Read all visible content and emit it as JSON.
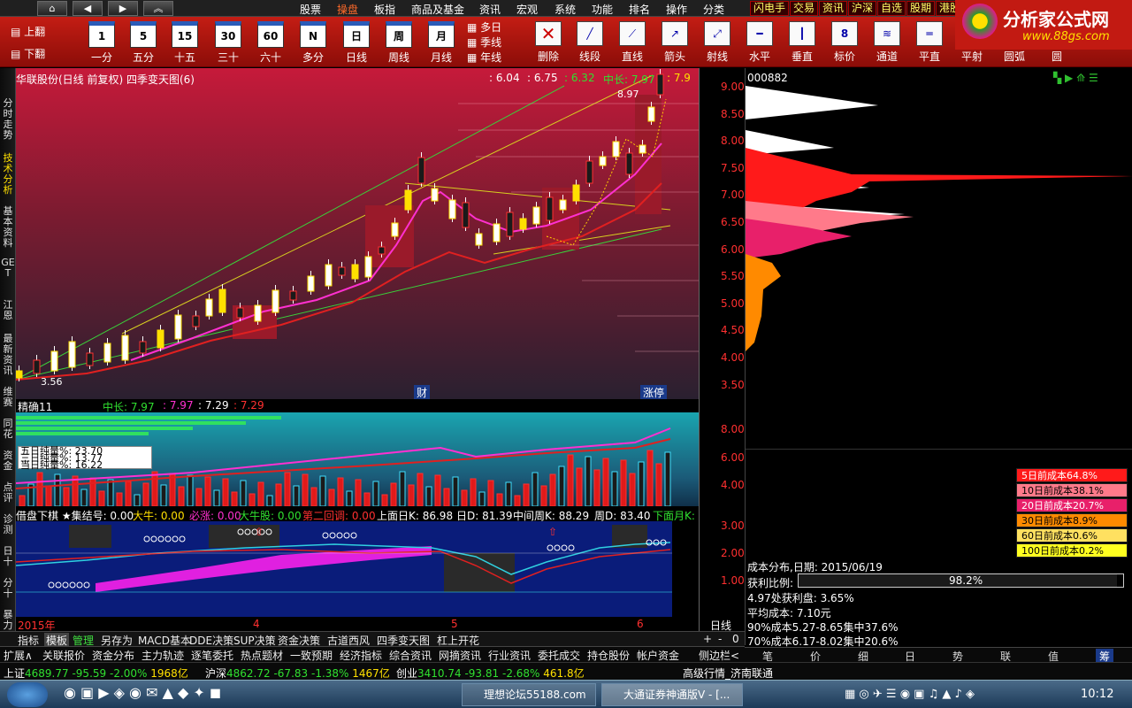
{
  "menubar": {
    "items": [
      "股票",
      "操盘",
      "板指",
      "商品及基金",
      "资讯",
      "宏观",
      "系统",
      "功能",
      "排名",
      "操作",
      "分类"
    ],
    "active_index": 1,
    "quick": [
      "闪电手",
      "交易",
      "资讯",
      "沪深",
      "自选",
      "股期",
      "港股"
    ],
    "nav": [
      "⌂",
      "◀",
      "▶",
      "︽"
    ]
  },
  "toolbar": {
    "flip": [
      "上翻",
      "下翻"
    ],
    "periods": [
      {
        "icon": "1",
        "label": "一分"
      },
      {
        "icon": "5",
        "label": "五分"
      },
      {
        "icon": "15",
        "label": "十五"
      },
      {
        "icon": "30",
        "label": "三十"
      },
      {
        "icon": "60",
        "label": "六十"
      },
      {
        "icon": "N",
        "label": "多分"
      },
      {
        "icon": "日",
        "label": "日线"
      },
      {
        "icon": "周",
        "label": "周线"
      },
      {
        "icon": "月",
        "label": "月线"
      }
    ],
    "multi": [
      "多日",
      "季线",
      "年线"
    ],
    "draw": [
      "删除",
      "线段",
      "直线",
      "箭头",
      "射线",
      "水平",
      "垂直",
      "标价",
      "通道",
      "平直",
      "平射",
      "圆弧",
      "圆"
    ]
  },
  "logo": {
    "title": "分析家公式网",
    "url": "www.88gs.com"
  },
  "leftnav": [
    "分时走势",
    "技术分析",
    "基本资料",
    "GET",
    "江恩",
    "最新资讯",
    "维赛",
    "同花",
    "资金",
    "点评",
    "诊测",
    "日十",
    "分十",
    "暴力"
  ],
  "main": {
    "title": "华联股份(日线 前复权) 四季变天图(6)",
    "vals": [
      ": 6.04",
      ": 6.75",
      ": 6.32",
      "中长: 7.97",
      ": 7.9"
    ],
    "price_labels": {
      "high": "8.97",
      "low": "3.56"
    },
    "badges": [
      "财",
      "涨停"
    ]
  },
  "scale_main": [
    "9.00",
    "8.50",
    "8.00",
    "7.50",
    "7.00",
    "6.50",
    "6.00",
    "5.50",
    "5.00",
    "4.50",
    "4.00",
    "3.50"
  ],
  "sub1": {
    "title": "精确11",
    "vals": [
      "中长: 7.97",
      ": 7.97",
      ": 7.29",
      ": 7.29"
    ],
    "legend": [
      "五日纯量%: 23.70",
      "三日纯量%: 13.77",
      "当日纯量%: 16.22"
    ]
  },
  "scale_sub1": [
    "8.00",
    "6.00",
    "4.00"
  ],
  "sub2": {
    "vals": [
      "借盘下棋 ★集结号: 0.00",
      "大牛: 0.00",
      "必涨: 0.00",
      "大牛股: 0.00",
      "第二回调: 0.00",
      "上面日K: 86.98",
      "日D: 81.39",
      "中间周K: 88.29",
      "周D: 83.40",
      "下面月K:"
    ]
  },
  "scale_sub2": [
    "3.00",
    "2.00",
    "1.00"
  ],
  "xaxis": {
    "labels": [
      "2015年",
      "4",
      "5",
      "6"
    ],
    "period": "日线"
  },
  "tabs1": [
    "指标",
    "模板",
    "管理",
    "另存为",
    "MACD基本",
    "DDE决策",
    "SUP决策",
    "资金决策",
    "古道西风",
    "四季变天图",
    "杠上开花"
  ],
  "tabs1_right": [
    "+",
    "-",
    "0"
  ],
  "tabs2": [
    "扩展∧",
    "关联报价",
    "资金分布",
    "主力轨迹",
    "逐笔委托",
    "热点题材",
    "一致预期",
    "经济指标",
    "综合资讯",
    "网摘资讯",
    "行业资讯",
    "委托成交",
    "持仓股份",
    "帐户资金",
    "侧边栏<"
  ],
  "right": {
    "code": "000882",
    "cost": [
      {
        "label": "5日前成本64.8%",
        "color": "#ff1a1a"
      },
      {
        "label": "10日前成本38.1%",
        "color": "#ff7a8a"
      },
      {
        "label": "20日前成本20.7%",
        "color": "#e8206a"
      },
      {
        "label": "30日前成本8.9%",
        "color": "#ff8a00"
      },
      {
        "label": "60日前成本0.6%",
        "color": "#ffe060"
      },
      {
        "label": "100日前成本0.2%",
        "color": "#ffff20"
      }
    ],
    "info": [
      "成本分布,日期: 2015/06/19",
      "获利比例:",
      "4.97处获利盘: 3.65%",
      "平均成本: 7.10元",
      "90%成本5.27-8.65集中37.6%",
      "70%成本6.17-8.02集中20.6%"
    ],
    "profit_ratio": "98.2%",
    "profit_fraction": 0.982,
    "tabs": [
      "笔",
      "价",
      "细",
      "日",
      "势",
      "联",
      "值",
      "筹"
    ]
  },
  "status": {
    "sh": {
      "name": "上证",
      "value": "4689.77",
      "chg": "-95.59",
      "pct": "-2.00%",
      "amt": "1968亿"
    },
    "sz": {
      "name": "沪深",
      "value": "4862.72",
      "chg": "-67.83",
      "pct": "-1.38%",
      "amt": "1467亿"
    },
    "cy": {
      "name": "创业",
      "value": "3410.74",
      "chg": "-93.81",
      "pct": "-2.68%",
      "amt": "461.8亿"
    },
    "feed": "高级行情_济南联通"
  },
  "taskbar": {
    "apps": [
      "理想论坛55188.com",
      "大通证券神通版V - [..."
    ],
    "time": "10:12"
  }
}
